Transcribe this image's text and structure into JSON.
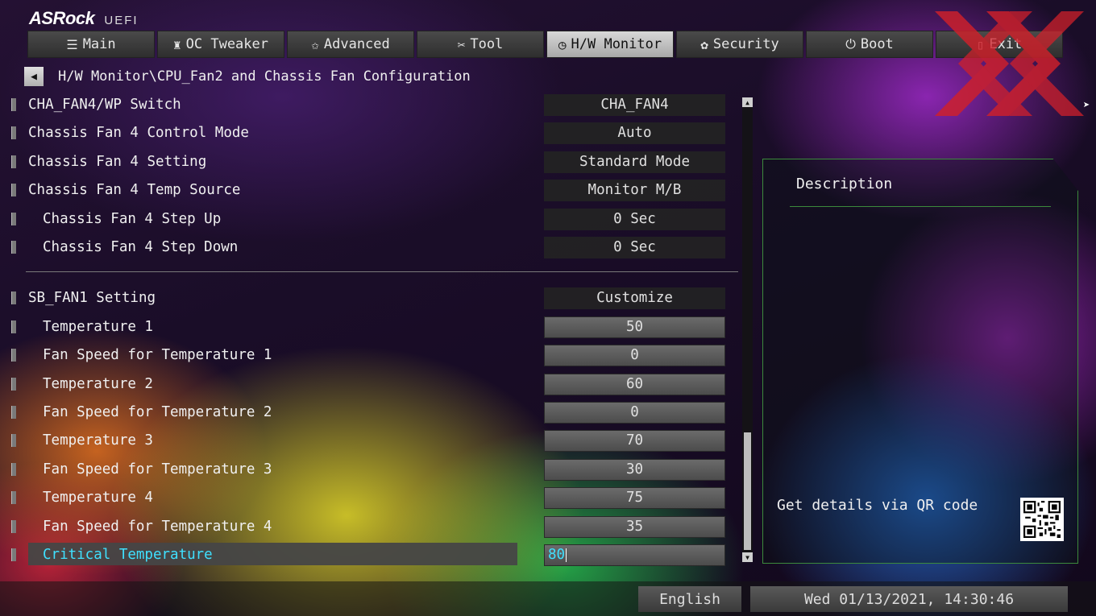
{
  "brand": {
    "name": "ASRock",
    "sub": "UEFI"
  },
  "tabs": [
    {
      "label": "Main",
      "icon": "list-icon",
      "glyph": "☰"
    },
    {
      "label": "OC Tweaker",
      "icon": "rocket-icon",
      "glyph": "♜"
    },
    {
      "label": "Advanced",
      "icon": "star-icon",
      "glyph": "✩"
    },
    {
      "label": "Tool",
      "icon": "tools-icon",
      "glyph": "✂"
    },
    {
      "label": "H/W Monitor",
      "icon": "monitor-icon",
      "glyph": "◷"
    },
    {
      "label": "Security",
      "icon": "shield-icon",
      "glyph": "✿"
    },
    {
      "label": "Boot",
      "icon": "power-icon",
      "glyph": "⏻"
    },
    {
      "label": "Exit",
      "icon": "exit-icon",
      "glyph": "▯"
    }
  ],
  "active_tab": "H/W Monitor",
  "breadcrumb": {
    "path": "H/W Monitor\\CPU_Fan2 and Chassis Fan Configuration"
  },
  "settings": [
    {
      "label": "CHA_FAN4/WP Switch",
      "value": "CHA_FAN4"
    },
    {
      "label": "Chassis Fan 4 Control Mode",
      "value": "Auto"
    },
    {
      "label": "Chassis Fan 4 Setting",
      "value": "Standard Mode"
    },
    {
      "label": "Chassis Fan 4 Temp Source",
      "value": "Monitor M/B"
    },
    {
      "label": "Chassis Fan 4 Step Up",
      "value": "0 Sec"
    },
    {
      "label": "Chassis Fan 4 Step Down",
      "value": "0 Sec"
    },
    {
      "label": "SB_FAN1 Setting",
      "value": "Customize"
    },
    {
      "label": "Temperature 1",
      "value": "50"
    },
    {
      "label": "Fan Speed for Temperature 1",
      "value": "0"
    },
    {
      "label": "Temperature 2",
      "value": "60"
    },
    {
      "label": "Fan Speed for Temperature 2",
      "value": "0"
    },
    {
      "label": "Temperature 3",
      "value": "70"
    },
    {
      "label": "Fan Speed for Temperature 3",
      "value": "30"
    },
    {
      "label": "Temperature 4",
      "value": "75"
    },
    {
      "label": "Fan Speed for Temperature 4",
      "value": "35"
    },
    {
      "label": "Critical Temperature",
      "value": "80"
    }
  ],
  "description": {
    "title": "Description",
    "qr_text": "Get details via QR code"
  },
  "footer": {
    "language": "English",
    "datetime": "Wed 01/13/2021, 14:30:46"
  },
  "colors": {
    "selected_text": "#3fe0ff",
    "panel_border": "#3c8a3c",
    "active_tab": "#c8c8c8",
    "watermark": "#d0202a"
  }
}
